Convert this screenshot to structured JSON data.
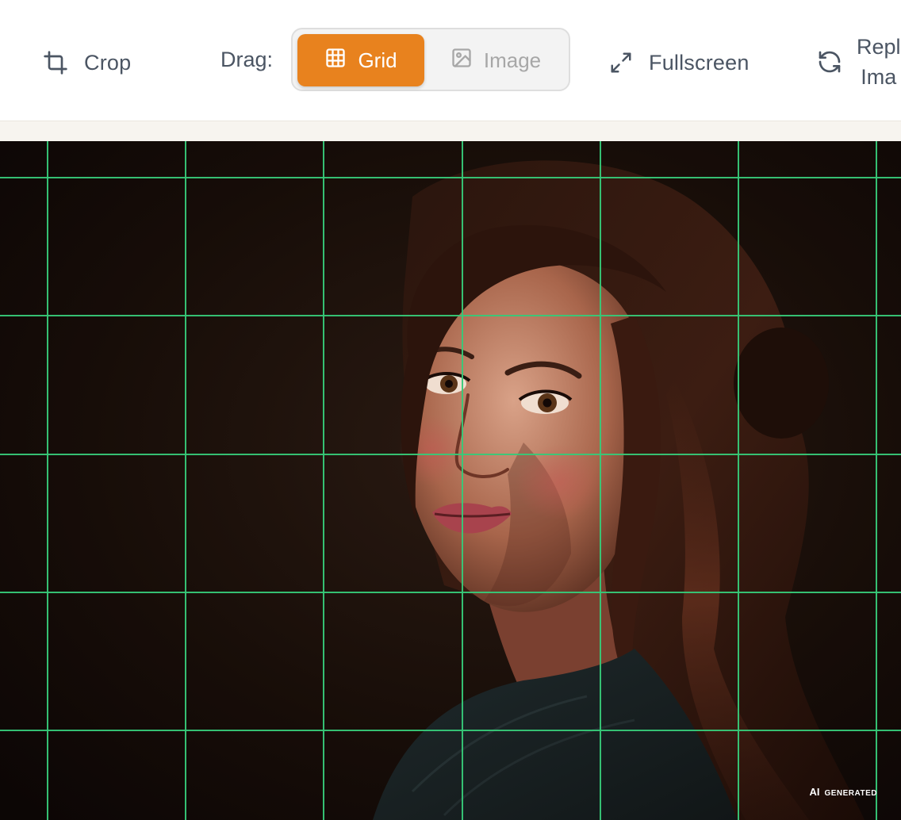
{
  "toolbar": {
    "crop": {
      "label": "Crop",
      "icon": "crop-icon"
    },
    "drag_label": "Drag:",
    "drag_mode": {
      "selected": "Grid",
      "options": [
        {
          "label": "Grid",
          "icon": "grid-icon"
        },
        {
          "label": "Image",
          "icon": "image-icon"
        }
      ]
    },
    "fullscreen": {
      "label": "Fullscreen",
      "icon": "expand-icon"
    },
    "replace": {
      "label_line1": "Repl",
      "label_line2": "Ima",
      "icon": "refresh-icon"
    }
  },
  "photo": {
    "badge_mark": "AI",
    "badge_text": "GENERATED"
  },
  "colors": {
    "accent": "#e8821e",
    "grid_line": "#37c978",
    "toolbar_text": "#4b5563",
    "segment_bg": "#f3f3f3",
    "photo_bg": "#140c08"
  }
}
